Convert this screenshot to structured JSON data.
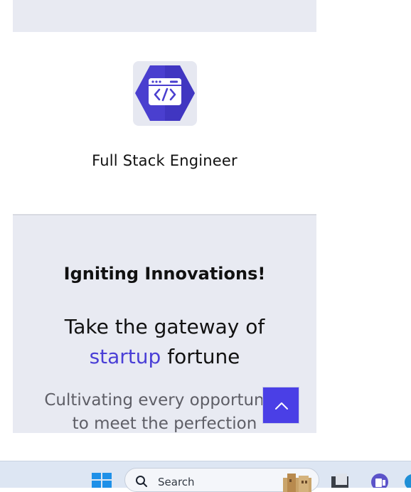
{
  "card": {
    "title": "Full Stack Engineer"
  },
  "hero": {
    "kicker": "Igniting Innovations!",
    "headline_main": "Take the gateway of ",
    "headline_accent": "startup",
    "headline_end": " fortune",
    "subtext": "Cultivating every opportunity to meet the perfection"
  },
  "scroll_top": {
    "icon": "chevron-up-icon"
  },
  "taskbar": {
    "search_placeholder": "Search",
    "icons": [
      "windows-start-icon",
      "search-icon",
      "file-explorer-icon",
      "teams-icon",
      "edge-icon"
    ]
  },
  "colors": {
    "accent": "#4a3fd6",
    "page_bg": "#e8eaf2",
    "card_bg": "#ffffff",
    "button": "#4a3fe6"
  }
}
